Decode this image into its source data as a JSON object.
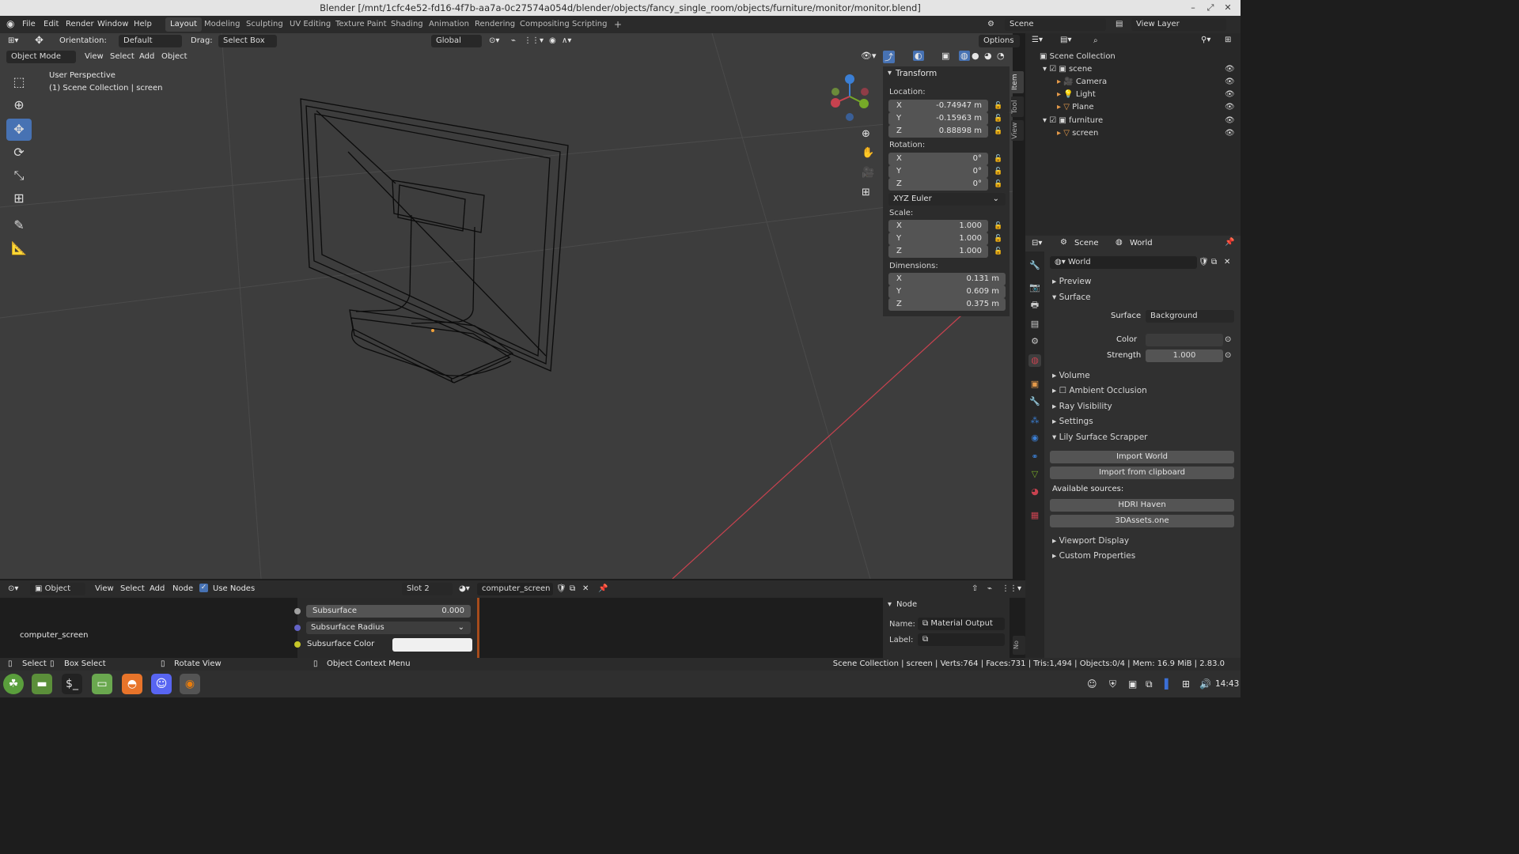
{
  "window": {
    "title": "Blender [/mnt/1cfc4e52-fd16-4f7b-aa7a-0c27574a054d/blender/objects/fancy_single_room/objects/furniture/monitor/monitor.blend]"
  },
  "menu": [
    "File",
    "Edit",
    "Render",
    "Window",
    "Help"
  ],
  "workspaces": [
    "Layout",
    "Modeling",
    "Sculpting",
    "UV Editing",
    "Texture Paint",
    "Shading",
    "Animation",
    "Rendering",
    "Compositing",
    "Scripting"
  ],
  "scene_name": "Scene",
  "view_layer": "View Layer",
  "header": {
    "orientation_label": "Orientation:",
    "orientation_value": "Default",
    "drag_label": "Drag:",
    "drag_value": "Select Box",
    "transform_space": "Global",
    "options": "Options"
  },
  "viewport": {
    "mode": "Object Mode",
    "menus": [
      "View",
      "Select",
      "Add",
      "Object"
    ],
    "overlay_line1": "User Perspective",
    "overlay_line2": "(1) Scene Collection | screen"
  },
  "npanel": {
    "title": "Transform",
    "location_label": "Location:",
    "loc": [
      "-0.74947 m",
      "-0.15963 m",
      "0.88898 m"
    ],
    "rotation_label": "Rotation:",
    "rot": [
      "0°",
      "0°",
      "0°"
    ],
    "rot_mode": "XYZ Euler",
    "scale_label": "Scale:",
    "scale": [
      "1.000",
      "1.000",
      "1.000"
    ],
    "dimensions_label": "Dimensions:",
    "dim": [
      "0.131 m",
      "0.609 m",
      "0.375 m"
    ],
    "axes": [
      "X",
      "Y",
      "Z"
    ],
    "tabs": [
      "Item",
      "Tool",
      "View"
    ]
  },
  "outliner": {
    "root": "Scene Collection",
    "items": [
      "scene",
      "Camera",
      "Light",
      "Plane",
      "furniture",
      "screen"
    ]
  },
  "properties": {
    "context": [
      "Scene",
      "World"
    ],
    "world_name": "World",
    "sections": {
      "preview": "Preview",
      "surface": "Surface",
      "volume": "Volume",
      "ao": "Ambient Occlusion",
      "ray": "Ray Visibility",
      "settings": "Settings",
      "lily": "Lily Surface Scrapper",
      "vpdisplay": "Viewport Display",
      "custom": "Custom Properties"
    },
    "surface_label": "Surface",
    "surface_value": "Background",
    "color_label": "Color",
    "strength_label": "Strength",
    "strength_value": "1.000",
    "import_world": "Import World",
    "import_clip": "Import from clipboard",
    "available": "Available sources:",
    "src1": "HDRI Haven",
    "src2": "3DAssets.one"
  },
  "node_editor": {
    "type": "Object",
    "menus": [
      "View",
      "Select",
      "Add",
      "Node"
    ],
    "use_nodes": "Use Nodes",
    "slot": "Slot 2",
    "material": "computer_screen",
    "frame_label": "computer_screen",
    "rows": [
      "Subsurface",
      "Subsurface Radius",
      "Subsurface Color"
    ],
    "subsurface_value": "0.000",
    "panel_title": "Node",
    "name_label": "Name:",
    "name_value": "Material Output",
    "label_label": "Label:",
    "side_tab": "No"
  },
  "status": {
    "select": "Select",
    "box": "Box Select",
    "rotate": "Rotate View",
    "ctx": "Object Context Menu",
    "stats": "Scene Collection | screen | Verts:764 | Faces:731 | Tris:1,494 | Objects:0/4 | Mem: 16.9 MiB | 2.83.0"
  },
  "taskbar": {
    "clock": "14:43"
  },
  "colors": {
    "accent": "#4772b3",
    "x_axis": "#c8424f",
    "y_axis": "#76a928",
    "z_axis": "#3b7fd5"
  }
}
